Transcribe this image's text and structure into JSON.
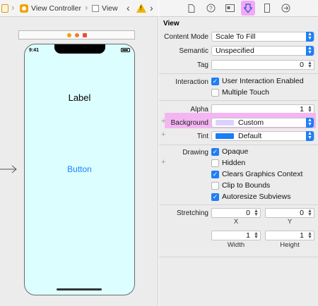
{
  "jumpbar": {
    "items": [
      "View Controller",
      "View"
    ],
    "back": "‹",
    "forward": "›",
    "warning": "!"
  },
  "phone": {
    "time": "9:41",
    "label": "Label",
    "button": "Button"
  },
  "inspector": {
    "section": "View",
    "content_mode": {
      "label": "Content Mode",
      "value": "Scale To Fill"
    },
    "semantic": {
      "label": "Semantic",
      "value": "Unspecified"
    },
    "tag": {
      "label": "Tag",
      "value": "0"
    },
    "interaction": {
      "label": "Interaction",
      "options": [
        {
          "text": "User Interaction Enabled",
          "checked": true
        },
        {
          "text": "Multiple Touch",
          "checked": false
        }
      ]
    },
    "alpha": {
      "label": "Alpha",
      "value": "1"
    },
    "background": {
      "label": "Background",
      "value": "Custom",
      "color": "#dcd2ff"
    },
    "tint": {
      "label": "Tint",
      "value": "Default",
      "color": "#1a7ef5"
    },
    "drawing": {
      "label": "Drawing",
      "options": [
        {
          "text": "Opaque",
          "checked": true
        },
        {
          "text": "Hidden",
          "checked": false
        },
        {
          "text": "Clears Graphics Context",
          "checked": true
        },
        {
          "text": "Clip to Bounds",
          "checked": false
        },
        {
          "text": "Autoresize Subviews",
          "checked": true
        }
      ]
    },
    "stretching": {
      "label": "Stretching",
      "x": "0",
      "y": "0",
      "width": "1",
      "height": "1",
      "x_label": "X",
      "y_label": "Y",
      "width_label": "Width",
      "height_label": "Height"
    }
  },
  "colors": {
    "accent": "#1f7ef5",
    "highlight": "#f4b6f2",
    "phone_bg": "#dcfeff"
  }
}
